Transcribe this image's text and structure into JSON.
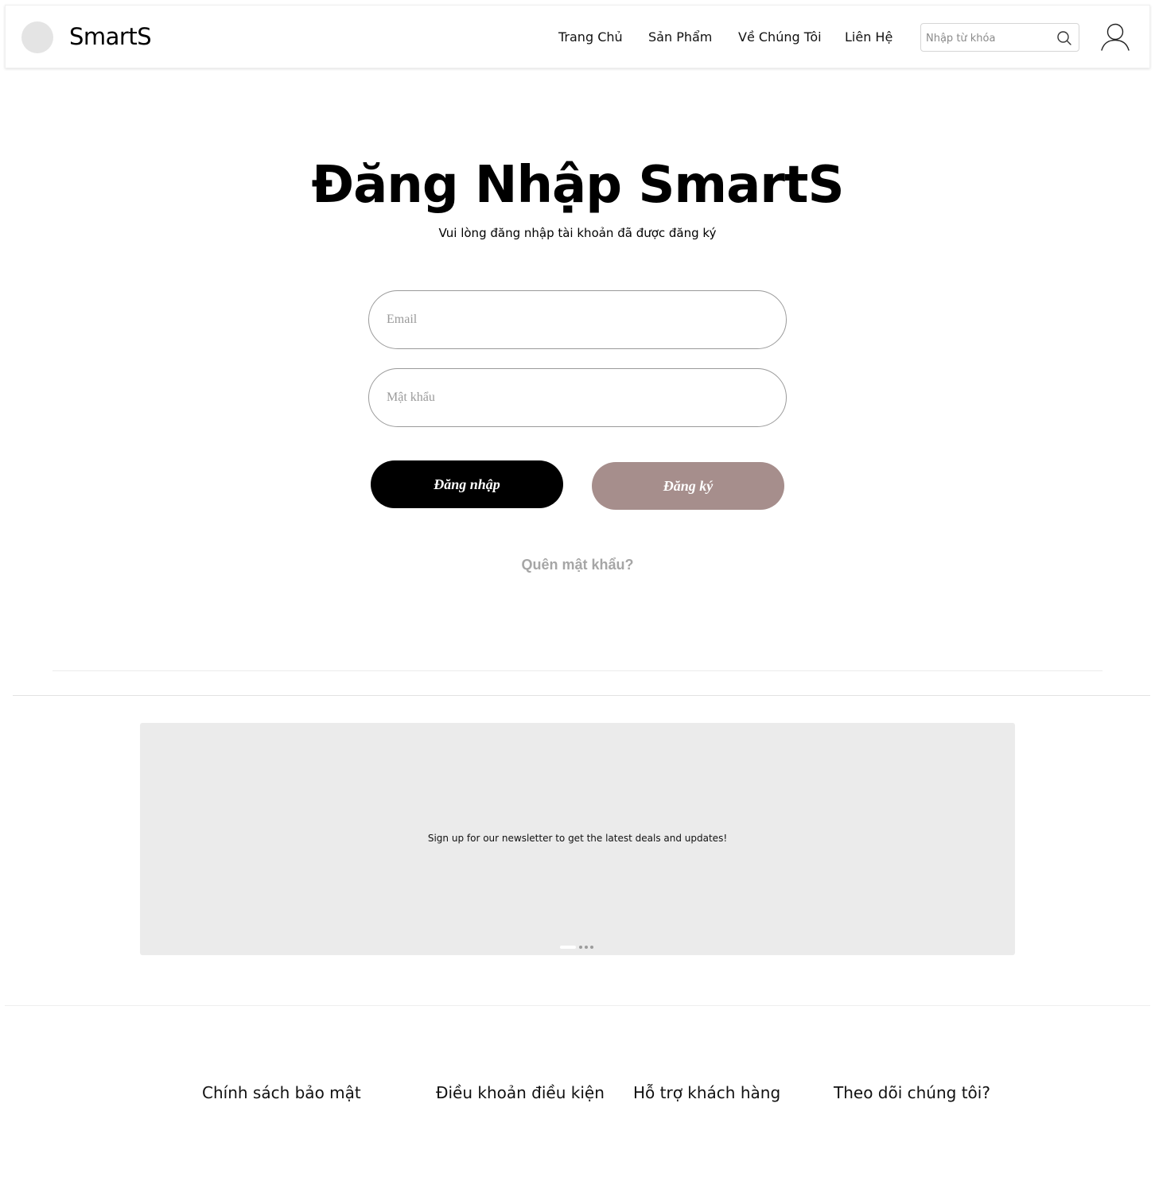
{
  "header": {
    "brand": "SmartS",
    "nav": {
      "home": "Trang Chủ",
      "products": "Sản Phẩm",
      "about": "Về Chúng Tôi",
      "contact": "Liên Hệ"
    },
    "search": {
      "placeholder": "Nhập từ khóa",
      "icon": "search-icon"
    },
    "user_icon": "user-icon"
  },
  "login": {
    "title": "Đăng Nhập SmartS",
    "subtitle": "Vui lòng đăng nhập tài khoản đã được đăng ký",
    "email_placeholder": "Email",
    "password_placeholder": "Mật khẩu",
    "login_button": "Đăng nhập",
    "register_button": "Đăng ký",
    "forgot_password": "Quên mật khẩu?"
  },
  "banner": {
    "text": "Sign up for our newsletter to get the latest deals and updates!",
    "slides": 4,
    "active_slide": 1
  },
  "footer": {
    "privacy": "Chính sách bảo mật",
    "terms": "Điều khoản điều kiện",
    "support": "Hỗ trợ khách hàng",
    "follow": "Theo dõi chúng tôi?"
  },
  "colors": {
    "login_button": "#000000",
    "register_button": "#a68e8c",
    "forgot_text": "#a6a6a6",
    "banner_bg": "#ebebeb"
  }
}
